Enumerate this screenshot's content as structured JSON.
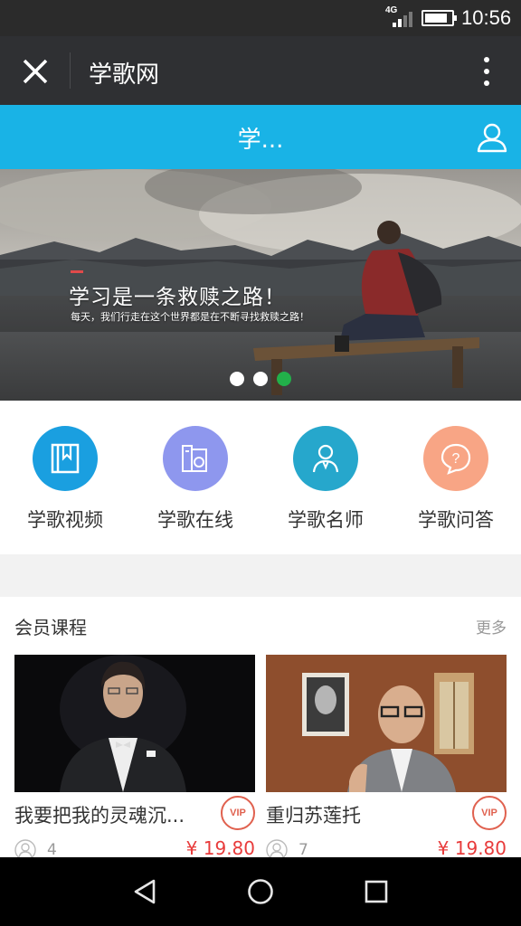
{
  "status_bar": {
    "network": "4G",
    "time": "10:56",
    "battery_level": 0.85
  },
  "title_bar": {
    "title": "学歌网"
  },
  "app_header": {
    "title": "学..."
  },
  "banner": {
    "headline": "学习是一条救赎之路！",
    "subline": "每天，我们行走在这个世界都是在不断寻找救赎之路！",
    "slides": 3,
    "active_slide": 3,
    "active_color": "#22b04a"
  },
  "quick_menu": [
    {
      "label": "学歌视频",
      "icon": "video-book-icon",
      "color": "#1a9fe0"
    },
    {
      "label": "学歌在线",
      "icon": "books-icon",
      "color": "#8e97ee"
    },
    {
      "label": "学歌名师",
      "icon": "teacher-icon",
      "color": "#26a7cc"
    },
    {
      "label": "学歌问答",
      "icon": "question-bubble-icon",
      "color": "#f8a585"
    }
  ],
  "section": {
    "title": "会员课程",
    "more_label": "更多",
    "courses": [
      {
        "title": "我要把我的灵魂沉...",
        "badge": "VIP",
        "learners": "4",
        "price": "¥ 19.80"
      },
      {
        "title": "重归苏莲托",
        "badge": "VIP",
        "learners": "7",
        "price": "¥ 19.80"
      }
    ]
  },
  "colors": {
    "accent": "#19b3e6",
    "price": "#e83b3b",
    "vip": "#e0614f"
  }
}
